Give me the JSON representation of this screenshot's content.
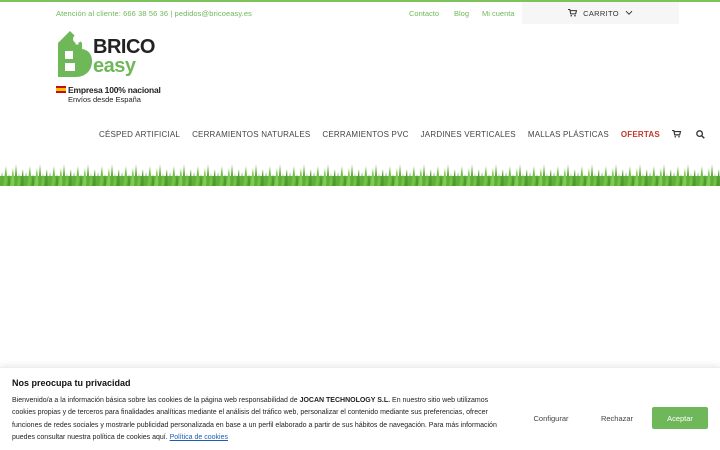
{
  "topbar": {
    "contact": "Atención al cliente: 666 38 56 36 | pedidos@bricoeasy.es",
    "links": [
      "Contacto",
      "Blog",
      "Mi cuenta"
    ],
    "cart_label": "CARRITO"
  },
  "logo": {
    "line1": "BRICO",
    "line2": "easy",
    "tagline1": "Empresa 100% nacional",
    "tagline2": "Envíos desde España"
  },
  "nav": {
    "items": [
      "CÉSPED ARTIFICIAL",
      "CERRAMIENTOS NATURALES",
      "CERRAMIENTOS PVC",
      "JARDINES VERTICALES",
      "MALLAS PLÁSTICAS",
      "OFERTAS"
    ]
  },
  "cookie_banner": {
    "title": "Nos preocupa tu privacidad",
    "text_part1": "Bienvenido/a a la información básica sobre las cookies de la página web responsabilidad de ",
    "company": "JOCAN TECHNOLOGY S.L.",
    "text_part2": " En nuestro sitio web utilizamos cookies propias y de terceros para finalidades analíticas mediante el análisis del tráfico web, personalizar el contenido mediante sus preferencias, ofrecer funciones de redes sociales y mostrarle publicidad personalizada en base a un perfil elaborado a partir de sus hábitos de navegación. Para más información puedes consultar nuestra política de cookies aquí. ",
    "policy_link": "Política de cookies",
    "configure_label": "Configurar",
    "reject_label": "Rechazar",
    "accept_label": "Aceptar"
  },
  "colors": {
    "brand_green": "#6fb85a",
    "offer_red": "#c0392b",
    "link_blue": "#1a5fb4"
  },
  "icons": [
    "cart-icon",
    "chevron-down-icon",
    "search-icon",
    "bulb-icon"
  ]
}
